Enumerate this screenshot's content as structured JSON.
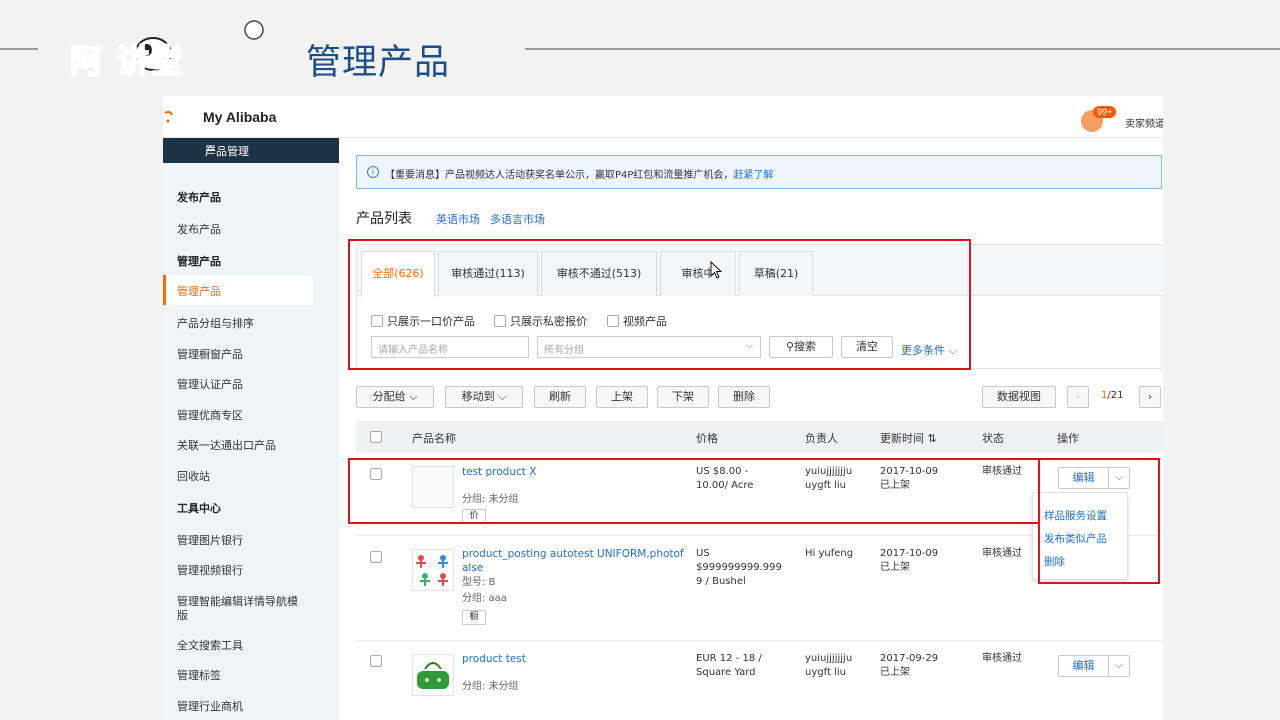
{
  "slide": {
    "logo_text": "阿 讲堂",
    "title": "管理产品"
  },
  "app": {
    "brand": "My Alibaba",
    "badge": "99+",
    "seller": "卖家频道"
  },
  "sidebar": {
    "header": "产品管理",
    "items": [
      {
        "label": "发布产品",
        "group": true
      },
      {
        "label": "发布产品"
      },
      {
        "label": "管理产品",
        "group": true
      },
      {
        "label": "管理产品",
        "active": true
      },
      {
        "label": "产品分组与排序"
      },
      {
        "label": "管理橱窗产品"
      },
      {
        "label": "管理认证产品"
      },
      {
        "label": "管理优商专区"
      },
      {
        "label": "关联一达通出口产品"
      },
      {
        "label": "回收站"
      },
      {
        "label": "工具中心",
        "group": true
      },
      {
        "label": "管理图片银行"
      },
      {
        "label": "管理视频银行"
      },
      {
        "label": "管理智能编辑详情导航模"
      },
      {
        "label": "版"
      },
      {
        "label": "全文搜索工具"
      },
      {
        "label": "管理标签"
      },
      {
        "label": "管理行业商机"
      }
    ]
  },
  "notice": {
    "text": "【重要消息】产品视频达人活动获奖名单公示，赢取P4P红包和流量推广机会，",
    "link": "赶紧了解"
  },
  "list": {
    "title": "产品列表",
    "market_en": "英语市场",
    "market_multi": "多语言市场"
  },
  "tabs": [
    "全部(626)",
    "审核通过(113)",
    "审核不通过(513)",
    "审核中",
    "草稿(21)"
  ],
  "filters": {
    "chk1": "只展示一口价产品",
    "chk2": "只展示私密报价",
    "chk3": "视频产品",
    "name_placeholder": "请输入产品名称",
    "group_select": "所有分组",
    "search": "搜索",
    "clear": "清空",
    "more": "更多条件"
  },
  "toolbar": {
    "assign": "分配给",
    "move": "移动到",
    "refresh": "刷新",
    "online": "上架",
    "offline": "下架",
    "delete": "删除",
    "dataview": "数据视图",
    "page_cur": "1",
    "page_total": "/21"
  },
  "table": {
    "headers": {
      "name": "产品名称",
      "price": "价格",
      "owner": "负责人",
      "updated": "更新时间",
      "status": "状态",
      "ops": "操作"
    },
    "rows": [
      {
        "name": "test product X",
        "meta1": "分组: 未分组",
        "meta2": "",
        "tag": "价",
        "price1": "US $8.00 -",
        "price2": "10.00/ Acre",
        "price3": "",
        "owner1": "yuiujjjjjjju",
        "owner2": "uygft liu",
        "date": "2017-10-09",
        "state": "已上架",
        "status": "审核通过",
        "edit": "编辑"
      },
      {
        "name": "product_posting autotest UNIFORM,photof",
        "name2": "alse",
        "meta1": "型号: B",
        "meta2": "分组: aaa",
        "tag": "橱",
        "price1": "US",
        "price2": "$999999999.999",
        "price3": "9 / Bushel",
        "owner1": "Hi yufeng",
        "owner2": "",
        "date": "2017-10-09",
        "state": "已上架",
        "status": "审核通过",
        "edit": "编辑"
      },
      {
        "name": "product test",
        "meta1": "分组: 未分组",
        "price1": "EUR 12 - 18 /",
        "price2": "Square Yard",
        "owner1": "yuiujjjjjjju",
        "owner2": "uygft liu",
        "date": "2017-09-29",
        "state": "已上架",
        "status": "审核通过",
        "edit": "编辑"
      }
    ]
  },
  "dropdown": {
    "item1": "样品服务设置",
    "item2": "发布类似产品",
    "item3": "删除"
  },
  "colors": {
    "accent": "#ff6a00",
    "link": "#1f6fd6",
    "highlight": "#d9141a",
    "slide_title": "#1d4e89"
  }
}
